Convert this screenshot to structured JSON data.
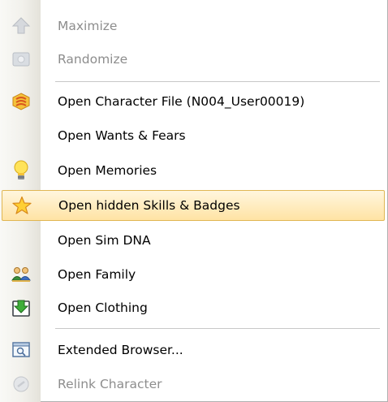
{
  "menu": {
    "items": [
      {
        "label": "Maximize",
        "icon": "arrow-up-icon",
        "disabled": true
      },
      {
        "label": "Randomize",
        "icon": "dice-icon",
        "disabled": true
      },
      {
        "label": "Open Character File (N004_User00019)",
        "icon": "character-file-icon",
        "disabled": false
      },
      {
        "label": "Open Wants & Fears",
        "icon": "",
        "disabled": false
      },
      {
        "label": "Open Memories",
        "icon": "lightbulb-icon",
        "disabled": false
      },
      {
        "label": "Open hidden Skills & Badges",
        "icon": "star-icon",
        "disabled": false,
        "highlighted": true
      },
      {
        "label": "Open Sim DNA",
        "icon": "",
        "disabled": false
      },
      {
        "label": "Open Family",
        "icon": "family-icon",
        "disabled": false
      },
      {
        "label": "Open Clothing",
        "icon": "clothing-icon",
        "disabled": false
      },
      {
        "label": "Extended Browser...",
        "icon": "browser-icon",
        "disabled": false
      },
      {
        "label": "Relink Character",
        "icon": "relink-icon",
        "disabled": true
      }
    ]
  },
  "colors": {
    "highlight_fill": "#ffe3a4",
    "highlight_border": "#e0b653",
    "disabled_text": "#8d8d8d"
  }
}
